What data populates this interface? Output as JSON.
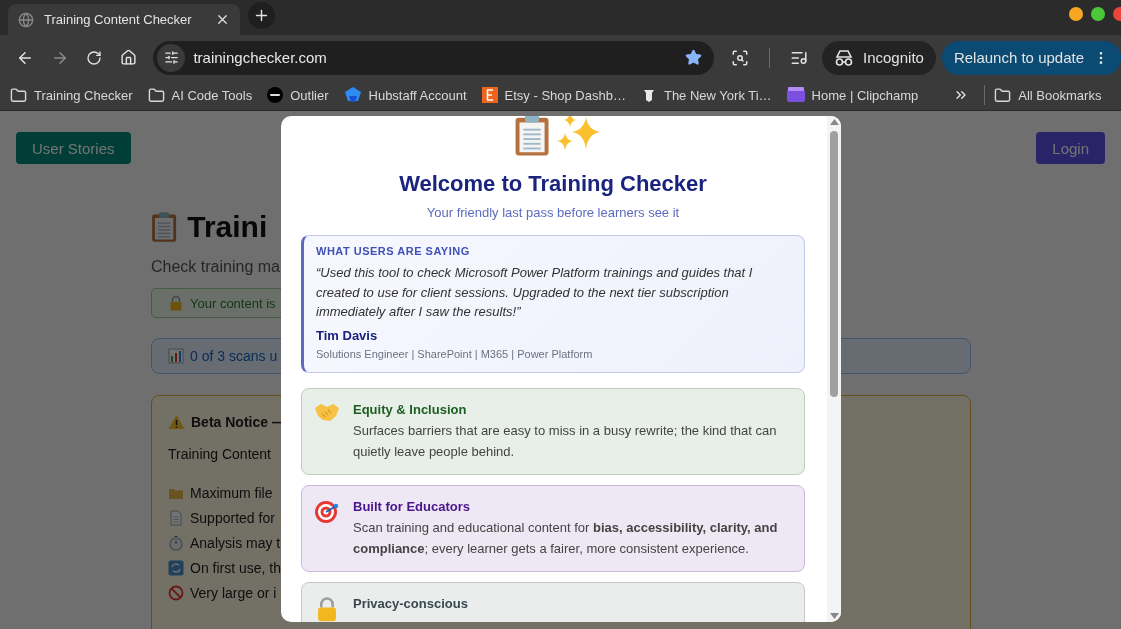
{
  "browser": {
    "tab": {
      "title": "Training Content Checker"
    },
    "url": "trainingchecker.com",
    "incognito": "Incognito",
    "relaunch": "Relaunch to update",
    "bookmarks": [
      {
        "kind": "folder",
        "label": "Training Checker"
      },
      {
        "kind": "folder",
        "label": "AI Code Tools"
      },
      {
        "kind": "outlier",
        "label": "Outlier"
      },
      {
        "kind": "hubstaff",
        "label": "Hubstaff Account"
      },
      {
        "kind": "etsy",
        "label": "Etsy - Shop Dashb…"
      },
      {
        "kind": "news",
        "label": "The New York Ti…"
      },
      {
        "kind": "clipchamp",
        "label": "Home | Clipchamp"
      }
    ],
    "all_bookmarks": "All Bookmarks"
  },
  "page": {
    "user_stories": "User Stories",
    "login": "Login",
    "title": "Traini",
    "subtitle": "Check training ma",
    "privacy_note": "Your content is",
    "scan_usage": "0 of 3 scans u",
    "beta_notice": {
      "title": "Beta Notice —",
      "intro": "Training Content",
      "items": [
        {
          "kind": "folder",
          "text": "Maximum file"
        },
        {
          "kind": "document",
          "text": "Supported for"
        },
        {
          "kind": "timer",
          "text": "Analysis may t"
        },
        {
          "kind": "refresh",
          "text": "On first use, th"
        },
        {
          "kind": "blocked",
          "text": "Very large or i"
        }
      ]
    }
  },
  "modal": {
    "title": "Welcome to Training Checker",
    "subtitle": "Your friendly last pass before learners see it",
    "testimonial": {
      "heading": "WHAT USERS ARE SAYING",
      "quote": "“Used this tool to check Microsoft Power Platform trainings and guides that I created to use for client sessions. Upgraded to the next tier subscription immediately after I saw the results!”",
      "author": "Tim Davis",
      "role": "Solutions Engineer | SharePoint | M365 | Power Platform"
    },
    "features": [
      {
        "kind": "handshake",
        "color": "#1b5e20",
        "title": "Equity & Inclusion",
        "body": "Surfaces barriers that are easy to miss in a busy rewrite; the kind that can quietly leave people behind."
      },
      {
        "kind": "target",
        "color": "#4a148c",
        "title": "Built for Educators",
        "body": "Scan training and educational content for **bias, accessibility, clarity, and compliance**; every learner gets a fairer, more consistent experience."
      },
      {
        "kind": "lock",
        "color": "#37474f",
        "title": "Privacy-conscious"
      }
    ]
  }
}
